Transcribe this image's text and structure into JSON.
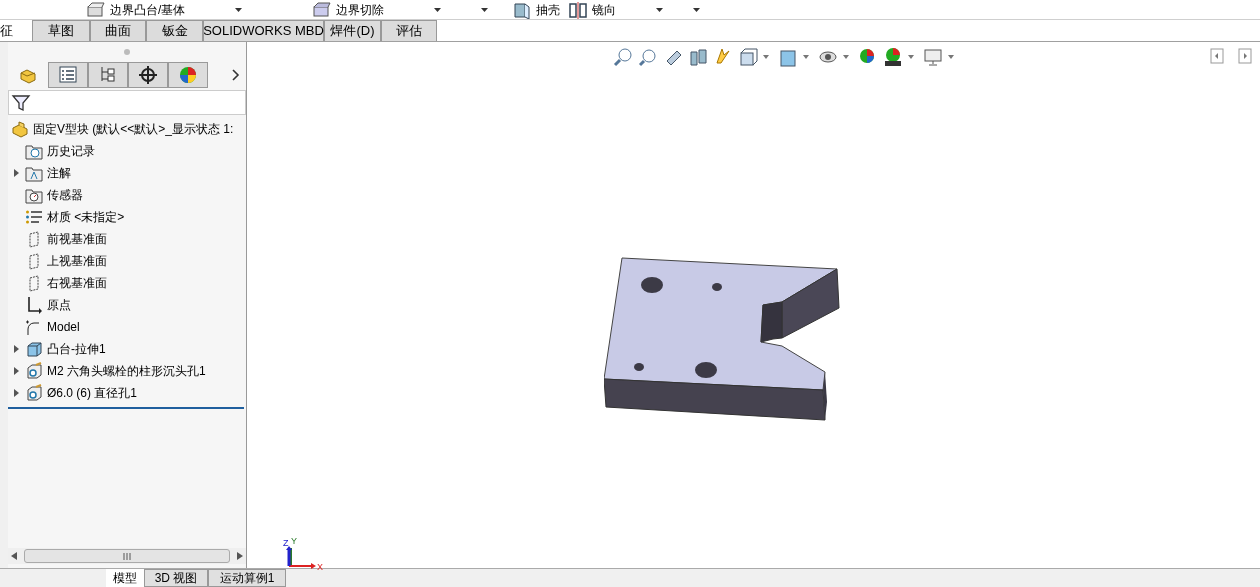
{
  "toolbar": {
    "items": [
      {
        "kind": "boss",
        "label": "边界凸台/基体"
      },
      {
        "kind": "dropdown"
      },
      {
        "kind": "cut",
        "label": "边界切除"
      },
      {
        "kind": "dropdown"
      },
      {
        "kind": "dropdown"
      },
      {
        "kind": "shell",
        "label": "抽壳"
      },
      {
        "kind": "mirror",
        "label": "镜向"
      },
      {
        "kind": "dropdown"
      },
      {
        "kind": "dropdown"
      }
    ]
  },
  "command_tabs": [
    {
      "label": "征",
      "selected": true
    },
    {
      "label": "草图",
      "selected": false
    },
    {
      "label": "曲面",
      "selected": false
    },
    {
      "label": "钣金",
      "selected": false
    },
    {
      "label": "SOLIDWORKS MBD",
      "selected": false
    },
    {
      "label": "焊件(D)",
      "selected": false
    },
    {
      "label": "评估",
      "selected": false
    }
  ],
  "panel_tabs": [
    {
      "kind": "feature",
      "selected": true
    },
    {
      "kind": "property",
      "selected": false
    },
    {
      "kind": "config",
      "selected": false
    },
    {
      "kind": "dimxpert",
      "selected": false
    },
    {
      "kind": "display",
      "selected": false
    }
  ],
  "tree": {
    "root": {
      "label": "固定V型块  (默认<<默认>_显示状态 1:",
      "children": [
        {
          "kind": "history",
          "label": "历史记录"
        },
        {
          "kind": "annotation",
          "label": "注解",
          "expanded": false
        },
        {
          "kind": "sensor",
          "label": "传感器"
        },
        {
          "kind": "material",
          "label": "材质 <未指定>"
        },
        {
          "kind": "plane",
          "label": "前视基准面"
        },
        {
          "kind": "plane",
          "label": "上视基准面"
        },
        {
          "kind": "plane",
          "label": "右视基准面"
        },
        {
          "kind": "origin",
          "label": "原点"
        },
        {
          "kind": "sketch",
          "label": "Model"
        },
        {
          "kind": "extrude",
          "label": "凸台-拉伸1",
          "expanded": false
        },
        {
          "kind": "hole",
          "label": "M2 六角头螺栓的柱形沉头孔1",
          "expanded": false
        },
        {
          "kind": "hole",
          "label": "Ø6.0 (6) 直径孔1",
          "expanded": false
        }
      ]
    }
  },
  "triad": {
    "x": "X",
    "y": "Y",
    "z": "Z"
  },
  "bottom_tabs": [
    {
      "label": "模型",
      "selected": true
    },
    {
      "label": "3D 视图",
      "selected": false
    },
    {
      "label": "运动算例1",
      "selected": false
    }
  ]
}
